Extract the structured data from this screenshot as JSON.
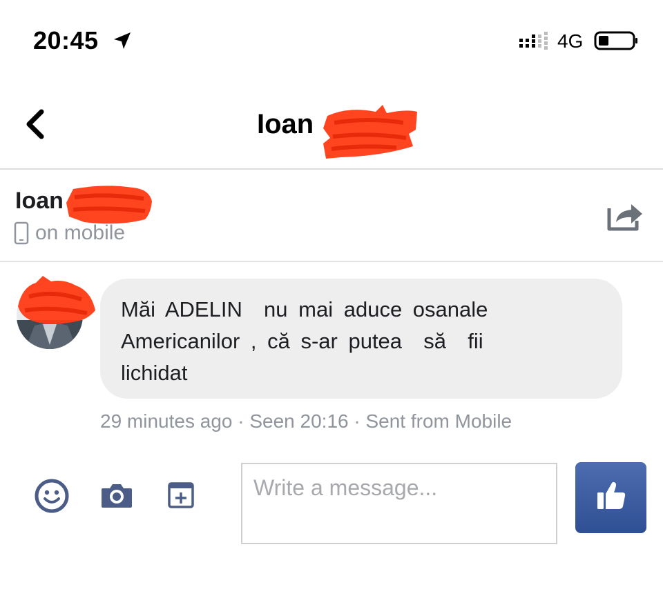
{
  "status_bar": {
    "time": "20:45",
    "network": "4G",
    "icons": [
      "location-arrow-icon",
      "signal-icon",
      "battery-icon"
    ]
  },
  "nav": {
    "back_icon": "chevron-left-icon",
    "title": "Ioan"
  },
  "contact": {
    "name": "Ioan",
    "presence": "on mobile",
    "presence_icon": "mobile-phone-icon",
    "action_icon": "share-icon"
  },
  "message": {
    "text": "Măi ADELIN  nu mai aduce osanale\nAmericanilor , că s-ar putea  să  fii\nlichidat",
    "meta": "29 minutes ago · Seen 20:16 · Sent from Mobile"
  },
  "composer": {
    "placeholder": "Write a message...",
    "value": "",
    "icons": [
      "emoji-icon",
      "camera-icon",
      "sticker-icon",
      "thumbs-up-icon"
    ]
  },
  "colors": {
    "bubble": "#eeeeef",
    "meta_text": "#90949c",
    "like_button": "#3b5998",
    "redaction": "#ff3b14"
  }
}
